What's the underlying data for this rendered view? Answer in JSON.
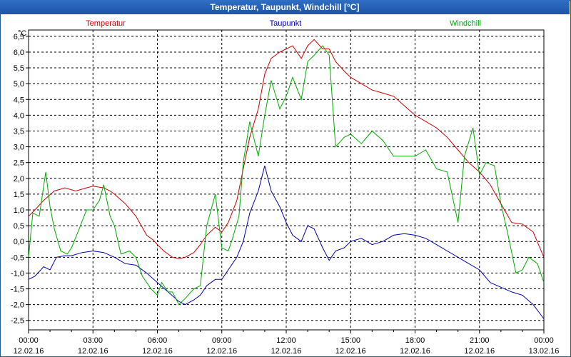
{
  "chart_data": {
    "type": "line",
    "title": "Temperatur, Taupunkt, Windchill [°C]",
    "ylabel": "°C",
    "ylim": [
      -2.8,
      6.7
    ],
    "xlim": [
      0,
      24
    ],
    "grid": true,
    "y_ticks": [
      "6,5",
      "6,0",
      "5,5",
      "5,0",
      "4,5",
      "4,0",
      "3,5",
      "3,0",
      "2,5",
      "2,0",
      "1,5",
      "1,0",
      "0,5",
      "0,0",
      "-0,5",
      "-1,0",
      "-1,5",
      "-2,0",
      "-2,5"
    ],
    "y_tick_values": [
      6.5,
      6.0,
      5.5,
      5.0,
      4.5,
      4.0,
      3.5,
      3.0,
      2.5,
      2.0,
      1.5,
      1.0,
      0.5,
      0.0,
      -0.5,
      -1.0,
      -1.5,
      -2.0,
      -2.5
    ],
    "x_ticks": [
      {
        "time": "00:00",
        "date": "12.02.16"
      },
      {
        "time": "03:00",
        "date": "12.02.16"
      },
      {
        "time": "06:00",
        "date": "12.02.16"
      },
      {
        "time": "09:00",
        "date": "12.02.16"
      },
      {
        "time": "12:00",
        "date": "12.02.16"
      },
      {
        "time": "15:00",
        "date": "12.02.16"
      },
      {
        "time": "18:00",
        "date": "12.02.16"
      },
      {
        "time": "21:00",
        "date": "12.02.16"
      },
      {
        "time": "00:00",
        "date": "13.02.16"
      }
    ],
    "x_tick_hours": [
      0,
      3,
      6,
      9,
      12,
      15,
      18,
      21,
      24
    ],
    "series": [
      {
        "name": "Temperatur",
        "color": "#cc0000",
        "x": [
          0,
          0.3,
          0.7,
          1.2,
          1.7,
          2.2,
          2.7,
          3.0,
          3.5,
          3.8,
          4.0,
          4.5,
          5.0,
          5.5,
          5.8,
          6.0,
          6.3,
          6.7,
          7.0,
          7.3,
          7.7,
          8.0,
          8.3,
          8.7,
          9.0,
          9.3,
          9.7,
          10.0,
          10.3,
          10.7,
          11.0,
          11.3,
          11.7,
          12.0,
          12.3,
          12.7,
          13.0,
          13.3,
          13.7,
          14.0,
          14.3,
          14.7,
          15.0,
          15.5,
          16.0,
          16.5,
          17.0,
          17.5,
          18.0,
          18.5,
          19.0,
          19.5,
          20.0,
          20.5,
          21.0,
          21.5,
          22.0,
          22.5,
          23.0,
          23.5,
          24.0
        ],
        "y": [
          0.8,
          1.0,
          1.3,
          1.6,
          1.7,
          1.6,
          1.7,
          1.75,
          1.7,
          1.6,
          1.5,
          1.2,
          0.8,
          0.2,
          0.05,
          -0.1,
          -0.3,
          -0.5,
          -0.55,
          -0.5,
          -0.35,
          -0.1,
          0.2,
          0.45,
          0.3,
          0.6,
          1.3,
          2.3,
          3.3,
          4.2,
          5.3,
          5.8,
          6.0,
          6.1,
          6.2,
          5.8,
          6.2,
          6.4,
          6.1,
          6.1,
          5.7,
          5.4,
          5.2,
          5.0,
          4.8,
          4.7,
          4.6,
          4.3,
          4.0,
          3.8,
          3.6,
          3.3,
          2.9,
          2.5,
          2.2,
          1.8,
          1.2,
          0.6,
          0.55,
          0.3,
          -0.5
        ],
        "legend_position": "top-left"
      },
      {
        "name": "Taupunkt",
        "color": "#0000aa",
        "x": [
          0,
          0.3,
          0.7,
          1.0,
          1.3,
          1.7,
          2.0,
          2.5,
          3.0,
          3.5,
          4.0,
          4.5,
          5.0,
          5.5,
          6.0,
          6.5,
          7.0,
          7.3,
          7.7,
          8.0,
          8.3,
          8.7,
          9.0,
          9.3,
          9.7,
          10.0,
          10.3,
          10.7,
          11.0,
          11.3,
          11.7,
          12.0,
          12.3,
          12.7,
          13.0,
          13.3,
          13.7,
          14.0,
          14.3,
          14.7,
          15.0,
          15.5,
          16.0,
          16.5,
          17.0,
          17.5,
          18.0,
          18.5,
          19.0,
          19.5,
          20.0,
          20.5,
          21.0,
          21.5,
          22.0,
          22.5,
          23.0,
          23.5,
          24.0
        ],
        "y": [
          -1.2,
          -1.1,
          -0.8,
          -0.9,
          -0.5,
          -0.45,
          -0.45,
          -0.35,
          -0.3,
          -0.35,
          -0.5,
          -0.7,
          -0.75,
          -1.0,
          -1.3,
          -1.6,
          -1.9,
          -2.0,
          -1.85,
          -1.7,
          -1.4,
          -1.2,
          -1.2,
          -0.9,
          -0.5,
          0.0,
          0.9,
          1.6,
          2.4,
          1.6,
          1.1,
          0.6,
          0.2,
          0.0,
          0.5,
          0.4,
          -0.2,
          -0.6,
          -0.3,
          -0.2,
          0.0,
          0.1,
          -0.1,
          0.0,
          0.2,
          0.25,
          0.2,
          0.1,
          -0.1,
          -0.3,
          -0.5,
          -0.7,
          -0.9,
          -1.3,
          -1.45,
          -1.6,
          -1.7,
          -2.0,
          -2.45
        ],
        "legend_position": "top-center"
      },
      {
        "name": "Windchill",
        "color": "#00aa00",
        "x": [
          0,
          0.2,
          0.5,
          0.8,
          1.0,
          1.2,
          1.5,
          1.8,
          2.0,
          2.3,
          2.7,
          3.0,
          3.3,
          3.5,
          3.8,
          4.0,
          4.3,
          4.7,
          5.0,
          5.3,
          5.7,
          6.0,
          6.2,
          6.5,
          6.7,
          7.0,
          7.3,
          7.7,
          8.0,
          8.3,
          8.7,
          9.0,
          9.3,
          9.5,
          9.8,
          10.0,
          10.3,
          10.7,
          11.0,
          11.3,
          11.7,
          12.0,
          12.3,
          12.7,
          13.0,
          13.3,
          13.7,
          14.0,
          14.3,
          14.7,
          15.0,
          15.5,
          16.0,
          16.5,
          17.0,
          17.5,
          18.0,
          18.5,
          19.0,
          19.5,
          20.0,
          20.3,
          20.7,
          21.0,
          21.3,
          21.7,
          22.0,
          22.3,
          22.7,
          23.0,
          23.3,
          23.7,
          24.0
        ],
        "y": [
          -0.5,
          0.9,
          0.8,
          2.2,
          1.1,
          0.4,
          -0.3,
          -0.4,
          -0.2,
          0.3,
          1.0,
          1.0,
          1.3,
          1.8,
          0.8,
          0.5,
          -0.4,
          -0.3,
          -0.5,
          -1.1,
          -1.5,
          -1.7,
          -1.3,
          -1.6,
          -1.6,
          -2.0,
          -1.8,
          -1.5,
          -1.4,
          0.5,
          1.5,
          -0.2,
          -0.3,
          0.1,
          0.8,
          2.5,
          3.8,
          2.7,
          4.0,
          5.1,
          4.2,
          4.6,
          5.2,
          4.5,
          5.7,
          5.9,
          6.2,
          5.9,
          3.0,
          3.3,
          3.4,
          3.1,
          3.5,
          3.2,
          2.7,
          2.7,
          2.7,
          2.9,
          2.3,
          2.2,
          0.6,
          2.7,
          3.6,
          2.1,
          2.5,
          2.4,
          1.2,
          0.3,
          -1.0,
          -0.9,
          -0.5,
          -0.7,
          -1.3
        ],
        "legend_position": "top-right"
      }
    ]
  }
}
